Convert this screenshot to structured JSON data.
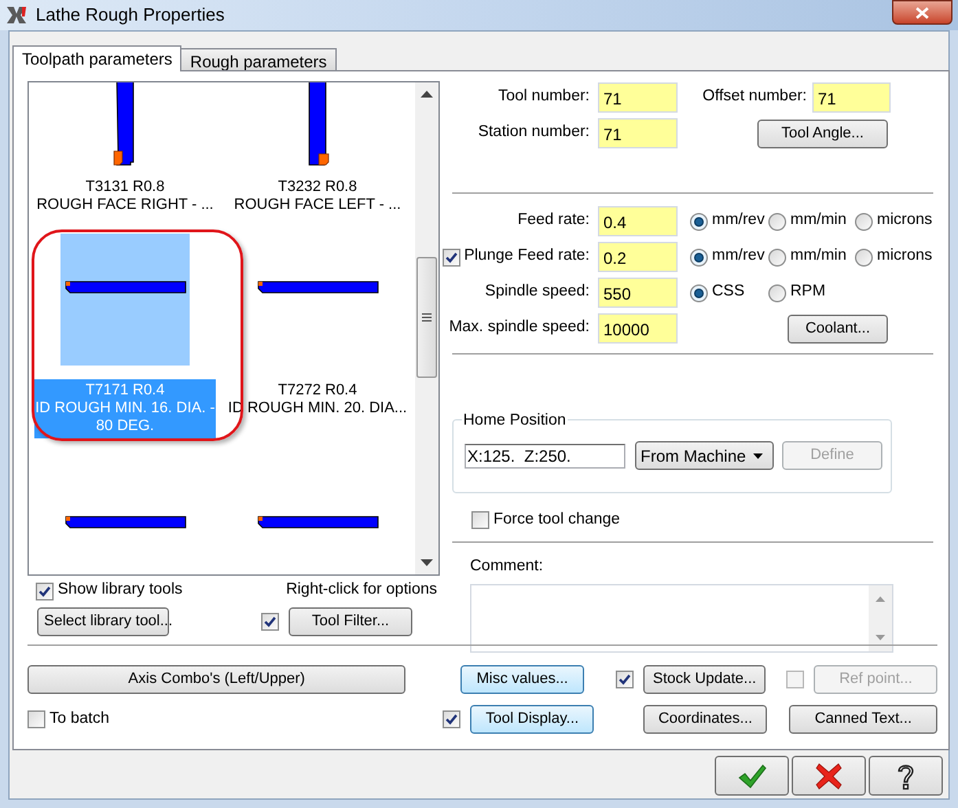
{
  "window": {
    "title": "Lathe Rough Properties"
  },
  "tabs": [
    {
      "label": "Toolpath parameters",
      "selected": true
    },
    {
      "label": "Rough parameters",
      "selected": false
    }
  ],
  "tool_list": {
    "items": [
      {
        "kind": "face-right",
        "name": "T3131 R0.8",
        "description": "ROUGH FACE RIGHT - ...",
        "selected": false
      },
      {
        "kind": "face-left",
        "name": "T3232 R0.8",
        "description": "ROUGH FACE LEFT - ...",
        "selected": false
      },
      {
        "kind": "boring-bar",
        "name": "T7171 R0.4",
        "description": "ID ROUGH MIN. 16. DIA. - 80 DEG.",
        "selected": true
      },
      {
        "kind": "boring-bar",
        "name": "T7272 R0.4",
        "description": "ID ROUGH MIN. 20. DIA...",
        "selected": false
      },
      {
        "kind": "boring-bar",
        "selected": false
      },
      {
        "kind": "boring-bar",
        "selected": false
      }
    ]
  },
  "show_library_tools": {
    "label": "Show library tools",
    "checked": true
  },
  "hint": "Right-click for options",
  "select_library_button": {
    "label": "Select library tool..."
  },
  "tool_filter": {
    "label": "Tool Filter...",
    "checked": true
  },
  "tool_fields": [
    {
      "label": "Tool number:",
      "value": "71"
    },
    {
      "label": "Offset number:",
      "value": "71"
    },
    {
      "label": "Station number:",
      "value": "71"
    }
  ],
  "tool_angle_button": {
    "label": "Tool Angle..."
  },
  "feed_rows": [
    {
      "label": "Feed rate:",
      "value": "0.4",
      "options": [
        {
          "label": "mm/rev",
          "selected": true
        },
        {
          "label": "mm/min",
          "selected": false
        },
        {
          "label": "microns",
          "selected": false
        }
      ]
    },
    {
      "label": "Plunge Feed rate:",
      "checked": true,
      "value": "0.2",
      "options": [
        {
          "label": "mm/rev",
          "selected": true
        },
        {
          "label": "mm/min",
          "selected": false
        },
        {
          "label": "microns",
          "selected": false
        }
      ]
    },
    {
      "label": "Spindle speed:",
      "value": "550",
      "options": [
        {
          "label": "CSS",
          "selected": true
        },
        {
          "label": "RPM",
          "selected": false
        }
      ]
    },
    {
      "label": "Max. spindle speed:",
      "value": "10000",
      "button": "Coolant..."
    }
  ],
  "home_position": {
    "title": "Home Position",
    "value": "X:125.  Z:250.",
    "mode": "From Machine",
    "define_button": {
      "label": "Define",
      "disabled": true
    }
  },
  "force_tool_change": {
    "label": "Force tool change",
    "checked": false
  },
  "comment": {
    "label": "Comment:"
  },
  "axis_combo_button": {
    "label": "Axis Combo's (Left/Upper)"
  },
  "misc_values_button": {
    "label": "Misc values...",
    "highlighted": true
  },
  "stock_update": {
    "label": "Stock Update...",
    "checked": true
  },
  "ref_point": {
    "label": "Ref point...",
    "checked": false,
    "disabled": true
  },
  "to_batch": {
    "label": "To batch",
    "checked": false
  },
  "tool_display": {
    "label": "Tool Display...",
    "checked": true,
    "highlighted": true
  },
  "coordinates_button": {
    "label": "Coordinates..."
  },
  "canned_text_button": {
    "label": "Canned Text..."
  },
  "dialog_buttons": [
    {
      "kind": "ok"
    },
    {
      "kind": "cancel"
    },
    {
      "kind": "help"
    }
  ]
}
